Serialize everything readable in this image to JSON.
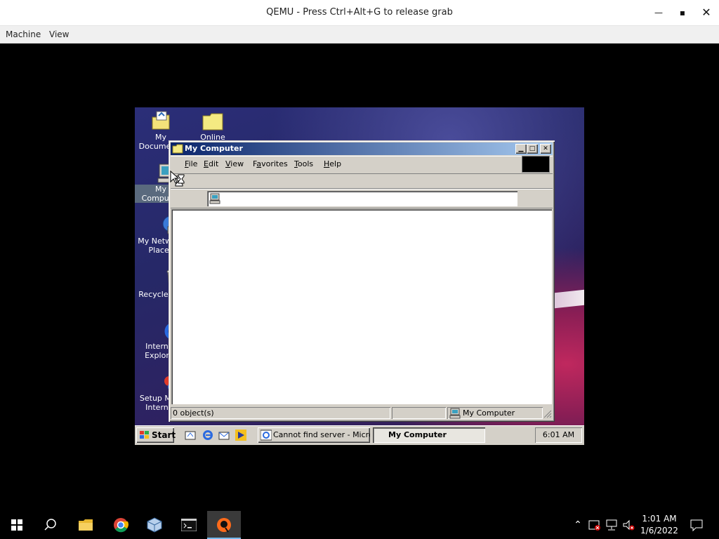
{
  "qemu": {
    "title": "QEMU - Press Ctrl+Alt+G to release grab",
    "menu": [
      "Machine",
      "View"
    ]
  },
  "desktop_icons": [
    {
      "label": "My Documents",
      "icon": "my-documents-icon"
    },
    {
      "label": "Online",
      "icon": "folder-icon"
    },
    {
      "label": "My Computer",
      "icon": "my-computer-icon"
    },
    {
      "label": "My Network Places",
      "icon": "network-places-icon"
    },
    {
      "label": "Recycle Bin",
      "icon": "recycle-bin-icon"
    },
    {
      "label": "Internet Explorer",
      "icon": "internet-explorer-icon"
    },
    {
      "label": "Setup MSN Internet",
      "icon": "msn-setup-icon"
    }
  ],
  "window": {
    "title": "My Computer",
    "menu": [
      {
        "label": "File",
        "mnemonic": "F",
        "rest": "ile"
      },
      {
        "label": "Edit",
        "mnemonic": "E",
        "rest": "dit"
      },
      {
        "label": "View",
        "mnemonic": "V",
        "rest": "iew"
      },
      {
        "label": "Favorites",
        "mnemonic": "a",
        "pre": "F",
        "rest": "vorites"
      },
      {
        "label": "Tools",
        "mnemonic": "T",
        "rest": "ools"
      },
      {
        "label": "Help",
        "mnemonic": "H",
        "rest": "elp"
      }
    ],
    "status": {
      "objects": "0 object(s)",
      "location": "My Computer"
    }
  },
  "guest_taskbar": {
    "start": "Start",
    "quick_launch": [
      "show-desktop-icon",
      "internet-explorer-icon",
      "outlook-express-icon",
      "media-player-icon"
    ],
    "tasks": [
      {
        "label": "Cannot find server - Micros...",
        "active": false
      },
      {
        "label": "My Computer",
        "active": true
      }
    ],
    "clock": "6:01 AM"
  },
  "host_taskbar": {
    "pinned": [
      "start-icon",
      "search-icon",
      "file-explorer-icon",
      "chrome-icon",
      "virtualbox-icon",
      "terminal-icon",
      "qemu-icon"
    ],
    "tray_icons": [
      "chevron-up-icon",
      "network-warning-icon",
      "ethernet-icon",
      "volume-muted-icon"
    ],
    "time": "1:01 AM",
    "date": "1/6/2022"
  },
  "colors": {
    "title_active_start": "#0a246a",
    "title_active_end": "#a6caf0",
    "win_face": "#d4d0c8"
  }
}
